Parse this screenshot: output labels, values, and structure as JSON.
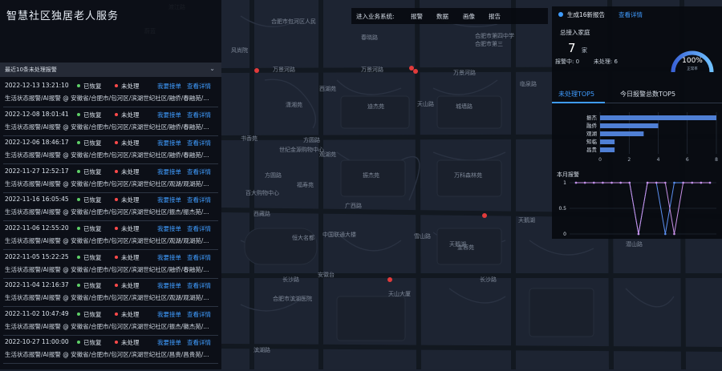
{
  "app": {
    "title": "智慧社区独居老人服务"
  },
  "alarm_list": {
    "title": "最近10条未处理报警",
    "records": [
      {
        "date": "2022-12-13 13:21:10",
        "status1": "已恢复",
        "status2": "未处理",
        "action1": "我要接单",
        "action2": "查看详情",
        "desc": "生活状态报警/AI报警   @ 安徽省/合肥市/包河区/滨湖世纪社区/融侨/春融苑/..."
      },
      {
        "date": "2022-12-08 18:01:41",
        "status1": "已恢复",
        "status2": "未处理",
        "action1": "我要接单",
        "action2": "查看详情",
        "desc": "生活状态报警/AI报警   @ 安徽省/合肥市/包河区/滨湖世纪社区/融侨/春融苑/..."
      },
      {
        "date": "2022-12-06 18:46:17",
        "status1": "已恢复",
        "status2": "未处理",
        "action1": "我要接单",
        "action2": "查看详情",
        "desc": "生活状态报警/AI报警   @ 安徽省/合肥市/包河区/滨湖世纪社区/融侨/春融苑/..."
      },
      {
        "date": "2022-11-27 12:52:17",
        "status1": "已恢复",
        "status2": "未处理",
        "action1": "我要接单",
        "action2": "查看详情",
        "desc": "生活状态报警/AI报警   @ 安徽省/合肥市/包河区/滨湖世纪社区/观湖/观湖苑/..."
      },
      {
        "date": "2022-11-16 16:05:45",
        "status1": "已恢复",
        "status2": "未处理",
        "action1": "我要接单",
        "action2": "查看详情",
        "desc": "生活状态报警/AI报警   @ 安徽省/合肥市/包河区/滨湖世纪社区/振杰/振杰苑/..."
      },
      {
        "date": "2022-11-06 12:55:20",
        "status1": "已恢复",
        "status2": "未处理",
        "action1": "我要接单",
        "action2": "查看详情",
        "desc": "生活状态报警/AI报警   @ 安徽省/合肥市/包河区/滨湖世纪社区/观湖/观湖苑/..."
      },
      {
        "date": "2022-11-05 15:22:25",
        "status1": "已恢复",
        "status2": "未处理",
        "action1": "我要接单",
        "action2": "查看详情",
        "desc": "生活状态报警/AI报警   @ 安徽省/合肥市/包河区/滨湖世纪社区/融侨/春融苑/..."
      },
      {
        "date": "2022-11-04 12:16:37",
        "status1": "已恢复",
        "status2": "未处理",
        "action1": "我要接单",
        "action2": "查看详情",
        "desc": "生活状态报警/AI报警   @ 安徽省/合肥市/包河区/滨湖世纪社区/观湖/观湖苑/..."
      },
      {
        "date": "2022-11-02 10:47:49",
        "status1": "已恢复",
        "status2": "未处理",
        "action1": "我要接单",
        "action2": "查看详情",
        "desc": "生活状态报警/AI报警   @ 安徽省/合肥市/包河区/滨湖世纪社区/振杰/徽杰苑/..."
      },
      {
        "date": "2022-10-27 11:00:00",
        "status1": "已恢复",
        "status2": "未处理",
        "action1": "我要接单",
        "action2": "查看详情",
        "desc": "生活状态报警/AI报警   @ 安徽省/合肥市/包河区/滨湖世纪社区/昌贵/昌贵苑/..."
      }
    ]
  },
  "topnav": {
    "label": "进入业务系统:",
    "tabs": [
      "报警",
      "数据",
      "画像",
      "报告"
    ]
  },
  "notice": {
    "text": "生成16新报告",
    "link": "查看详情"
  },
  "families": {
    "title": "总接入家庭",
    "count": "7",
    "unit": "家",
    "alarm_label": "报警中:",
    "alarm_value": "0",
    "pending_label": "未处理:",
    "pending_value": "6"
  },
  "gauge": {
    "value_text": "100%",
    "sub": "正常率",
    "fraction": 1.0
  },
  "tabs": {
    "tab1": "未处理TOP5",
    "tab2": "今日报警总数TOP5"
  },
  "chart_data": [
    {
      "type": "bar",
      "orientation": "horizontal",
      "categories": [
        "振杰",
        "融侨",
        "观湖",
        "知临",
        "昌贵"
      ],
      "values": [
        8,
        4,
        3,
        1,
        1
      ],
      "xlim": [
        0,
        8
      ],
      "xticks": [
        "0",
        "2",
        "4",
        "6",
        "8"
      ],
      "color": "#4f7fd4"
    },
    {
      "type": "line",
      "title": "本月报警",
      "yticks": [
        "1",
        "0.5",
        "0"
      ],
      "ylim": [
        0,
        1
      ],
      "series": [
        {
          "color": "#5b8ff0",
          "values": [
            1,
            1,
            1,
            1,
            1,
            1,
            1,
            0,
            1,
            1,
            0,
            1,
            1,
            1,
            1,
            1
          ]
        },
        {
          "color": "#c890e6",
          "values": [
            1,
            1,
            1,
            1,
            1,
            1,
            1,
            0,
            1,
            1,
            1,
            0,
            1,
            1,
            1,
            1
          ]
        }
      ]
    }
  ],
  "map": {
    "labels": [
      "渡江路",
      "蔚蓝",
      "合肥市包河区人民",
      "风尚院",
      "合肥市第四中学",
      "合肥市第三",
      "春晓路",
      "万景河路",
      "万景河路",
      "万景河路",
      "西湖苑",
      "天山路",
      "潇湘苑",
      "迪杰苑",
      "城墙路",
      "临泉路",
      "书香苑",
      "方圆路",
      "方圆路",
      "世纪金源购物中心",
      "观湖苑",
      "福寿苑",
      "百大购物中心",
      "万科森林苑",
      "振杰苑",
      "西藏路",
      "广西路",
      "雪山路",
      "恒大名都",
      "中国联通大楼",
      "金蓉苑",
      "天鹅湖",
      "潜山路",
      "长沙路",
      "长沙路",
      "安徽台",
      "天山大厦",
      "合肥市滨湖医院",
      "滨湖路",
      "天鹅湖"
    ]
  },
  "colors": {
    "accent": "#3f9cff",
    "ok": "#5fd068",
    "alert": "#ff4a4a",
    "panel": "#0a0d13"
  }
}
